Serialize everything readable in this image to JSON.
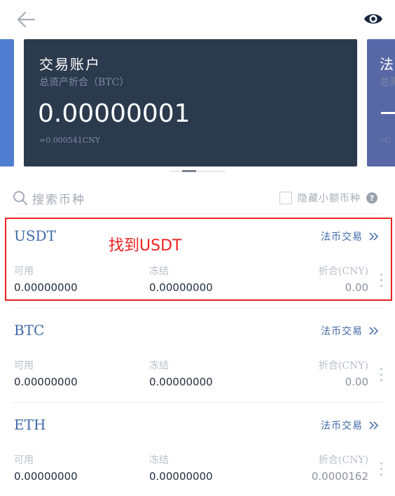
{
  "header": {
    "back_icon": "arrow-left-icon",
    "eye_icon": "eye-icon"
  },
  "cards": {
    "main": {
      "title": "交易账户",
      "subtitle": "总资产折合（BTC）",
      "amount": "0.00000001",
      "cny": "≈0.000541CNY"
    },
    "right": {
      "title": "法币",
      "subtitle": "总资",
      "cny": "--C"
    },
    "colors": {
      "left": "#4f7ed0",
      "main": "#2c3a4e",
      "right": "#5868a6"
    }
  },
  "search": {
    "placeholder": "搜索币种"
  },
  "filter": {
    "hide_small_label": "隐藏小额币种",
    "help_icon": "?"
  },
  "assets": [
    {
      "coin": "USDT",
      "fiat_label": "法币交易",
      "available_label": "可用",
      "available": "0.00000000",
      "frozen_label": "冻结",
      "frozen": "0.00000000",
      "cny_label": "折合(CNY)",
      "cny": "0.00"
    },
    {
      "coin": "BTC",
      "fiat_label": "法币交易",
      "available_label": "可用",
      "available": "0.00000000",
      "frozen_label": "冻结",
      "frozen": "0.00000000",
      "cny_label": "折合(CNY)",
      "cny": "0.00"
    },
    {
      "coin": "ETH",
      "fiat_label": "法币交易",
      "available_label": "可用",
      "available": "0.00000000",
      "frozen_label": "冻结",
      "frozen": "0.00000000",
      "cny_label": "折合(CNY)",
      "cny": "0.0000162"
    }
  ],
  "annotation": {
    "text": "找到USDT",
    "color": "#e8231e"
  }
}
